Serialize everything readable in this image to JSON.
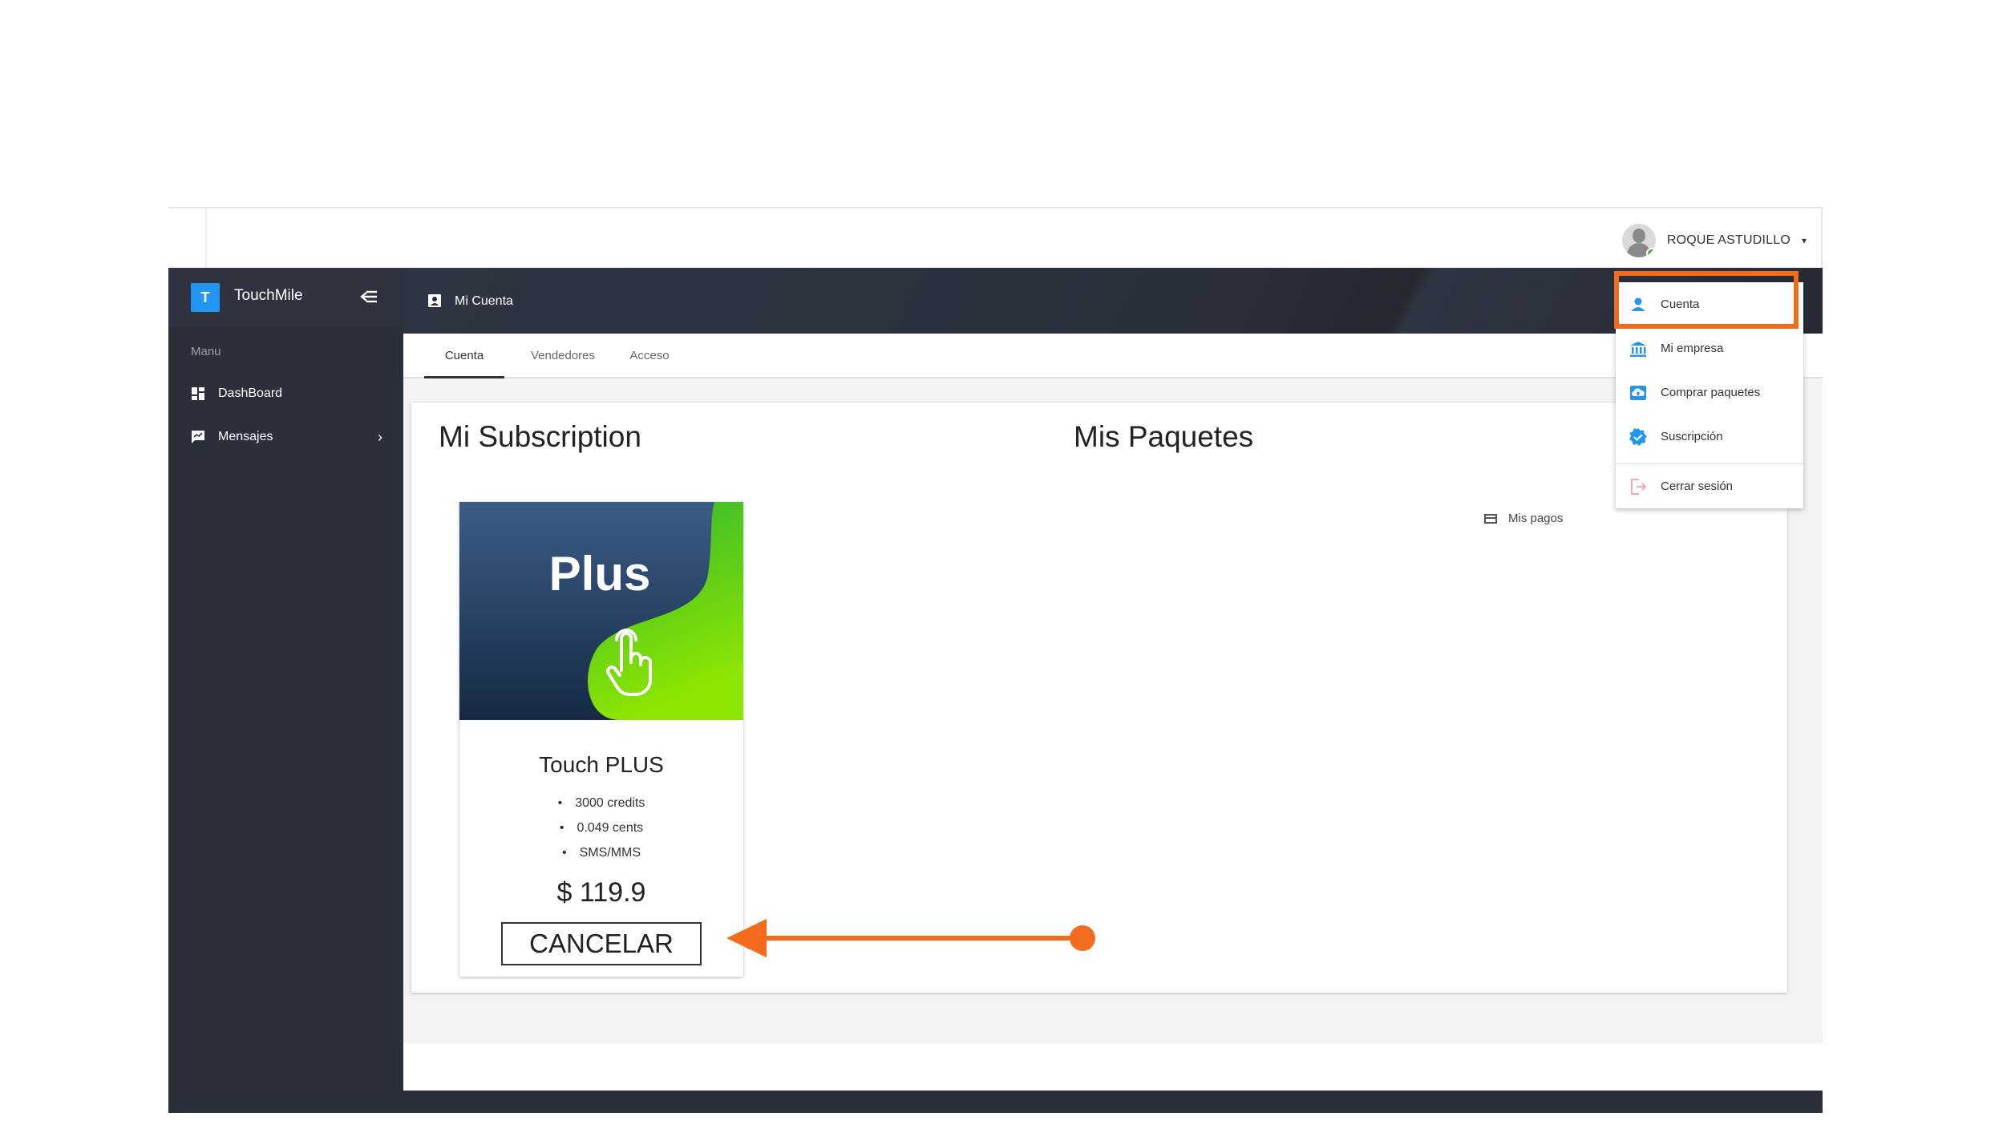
{
  "user": {
    "name": "ROQUE ASTUDILLO",
    "caret": "▾"
  },
  "sidebar": {
    "brand_initial": "T",
    "brand_name": "TouchMile",
    "menu_label": "Manu",
    "items": [
      {
        "label": "DashBoard",
        "icon": "dashboard-icon"
      },
      {
        "label": "Mensajes",
        "icon": "message-icon",
        "chevron": "›"
      }
    ]
  },
  "header": {
    "title": "Mi Cuenta",
    "icon": "account-box-icon"
  },
  "tabs": [
    {
      "label": "Cuenta",
      "active": true
    },
    {
      "label": "Vendedores",
      "active": false
    },
    {
      "label": "Acceso",
      "active": false
    }
  ],
  "main": {
    "subscription_title": "Mi Subscription",
    "packages_title": "Mis Paquetes",
    "payments_label": "Mis pagos",
    "product": {
      "image_text": "Plus",
      "name": "Touch PLUS",
      "features": [
        "3000 credits",
        "0.049 cents",
        "SMS/MMS"
      ],
      "price": "$ 119.9",
      "cancel_label": "CANCELAR"
    }
  },
  "dropdown": {
    "items": [
      {
        "label": "Cuenta",
        "icon": "person-icon"
      },
      {
        "label": "Mi empresa",
        "icon": "bank-icon"
      },
      {
        "label": "Comprar paquetes",
        "icon": "cloud-upload-icon"
      },
      {
        "label": "Suscripción",
        "icon": "verified-badge-icon"
      },
      {
        "label": "Cerrar sesión",
        "icon": "logout-icon"
      }
    ]
  },
  "colors": {
    "accent_blue": "#2196f3",
    "sidebar": "#2b2f3a",
    "annotation_orange": "#f36b1c",
    "plus_green": "#6fd80a",
    "plus_navy": "#1f3656"
  }
}
